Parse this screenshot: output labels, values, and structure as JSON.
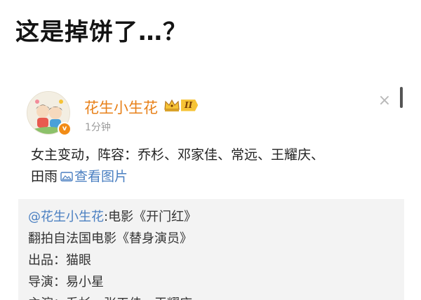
{
  "headline": "这是掉饼了…？",
  "post": {
    "username": "花生小生花",
    "vip_level": "II",
    "timestamp": "1分钟",
    "body_line1": "女主变动，阵容：乔杉、邓家佳、常远、王耀庆、",
    "body_line2_prefix": "田雨",
    "view_image_label": "查看图片",
    "close_glyph": "×",
    "verified_glyph": "v"
  },
  "repost": {
    "mention": "@花生小生花",
    "line1_rest": ":电影《开门红》",
    "line2": "翻拍自法国电影《替身演员》",
    "line3": "出品：猫眼",
    "line4": "导演：易小星",
    "line5_partial": "主演：乔杉、张天佳、王耀庆"
  },
  "icons": {
    "avatar": "cartoon-couple-avatar",
    "verified": "verified-badge-icon",
    "vip": "crown-icon",
    "close": "close-icon",
    "image": "image-icon"
  },
  "colors": {
    "username": "#e8811a",
    "link": "#4a7fc1",
    "verified": "#f28c16",
    "vip_gold": "#f6c336",
    "repost_bg": "#f3f3f3"
  }
}
